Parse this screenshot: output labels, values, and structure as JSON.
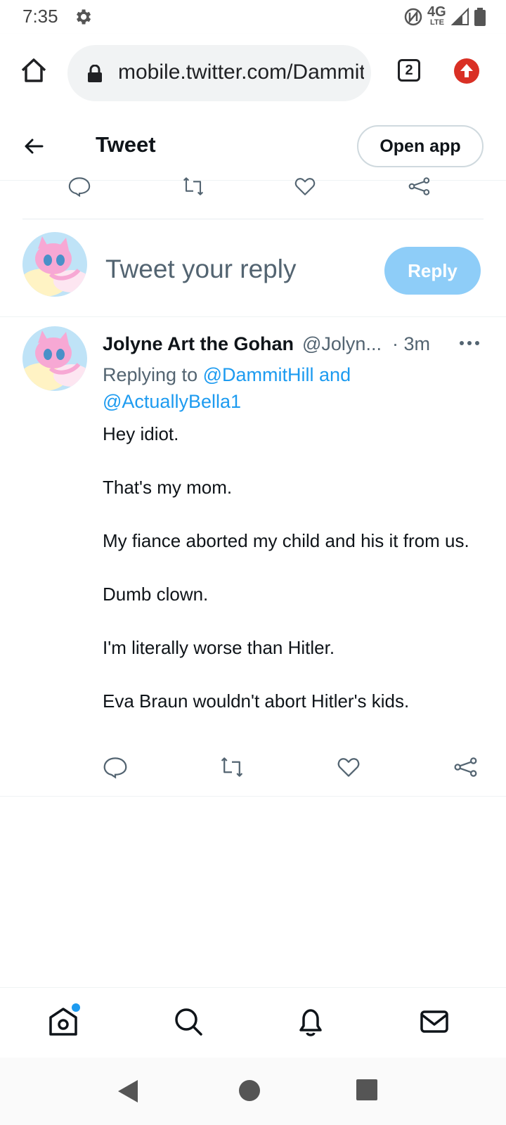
{
  "status_bar": {
    "time": "7:35",
    "network_label": "4G",
    "network_sub": "LTE"
  },
  "browser": {
    "url": "mobile.twitter.com/DammitHill",
    "tab_count": "2"
  },
  "header": {
    "title": "Tweet",
    "open_app_label": "Open app"
  },
  "reply_box": {
    "placeholder": "Tweet your reply",
    "reply_label": "Reply"
  },
  "tweet": {
    "author_name": "Jolyne Art the Gohan",
    "author_handle": "@Jolyn...",
    "time": "· 3m",
    "replying_prefix": "Replying to",
    "replying_to_1": "@DammitHill",
    "replying_and": "and",
    "replying_to_2": "@ActuallyBella1",
    "paragraphs": [
      "Hey idiot.",
      "That's my mom.",
      "My fiance aborted my child and his it from us.",
      "Dumb clown.",
      "I'm literally worse than Hitler.",
      "Eva Braun wouldn't abort Hitler's kids."
    ]
  },
  "colors": {
    "accent": "#1d9bf0",
    "reply_button": "#8ecdf8",
    "update_badge": "#d93025",
    "secondary_text": "#536471"
  },
  "icons": [
    "gear-icon",
    "nfc-icon",
    "signal-icon",
    "battery-icon",
    "home-icon",
    "lock-icon",
    "arrow-up-icon",
    "back-arrow-icon",
    "comment-icon",
    "retweet-icon",
    "like-icon",
    "share-icon",
    "more-icon",
    "nav-home-icon",
    "nav-search-icon",
    "nav-bell-icon",
    "nav-mail-icon"
  ]
}
